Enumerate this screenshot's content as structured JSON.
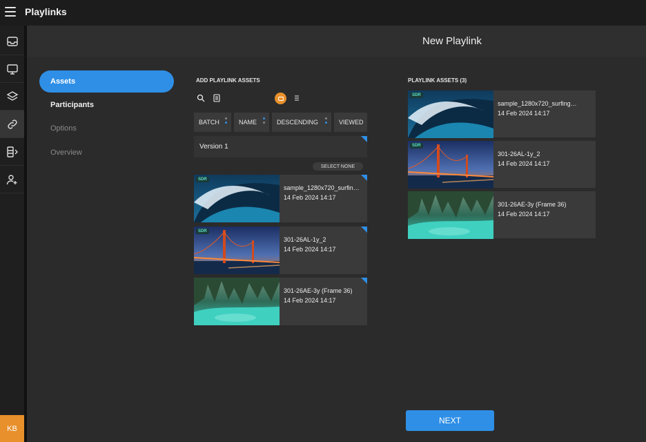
{
  "app": {
    "title": "Playlinks"
  },
  "header": {
    "title": "New Playlink"
  },
  "user": {
    "initials": "KB"
  },
  "colors": {
    "accent": "#2f8fe6",
    "highlight": "#e8902b",
    "sdr_badge": "#5de0c8"
  },
  "nav": [
    {
      "icon": "inbox-icon",
      "active": false
    },
    {
      "icon": "monitor-icon",
      "active": false
    },
    {
      "icon": "layers-icon",
      "active": false
    },
    {
      "icon": "link-icon",
      "active": true
    },
    {
      "icon": "storage-icon",
      "active": false
    },
    {
      "icon": "user-settings-icon",
      "active": false
    }
  ],
  "steps": [
    {
      "label": "Assets",
      "state": "active"
    },
    {
      "label": "Participants",
      "state": "done"
    },
    {
      "label": "Options",
      "state": "disabled"
    },
    {
      "label": "Overview",
      "state": "disabled"
    }
  ],
  "add_section": {
    "title": "ADD PLAYLINK ASSETS",
    "toolbar": {
      "search": "search-icon",
      "doc": "document-icon",
      "grid": "tile-view-icon",
      "list": "list-view-icon"
    },
    "sort": {
      "batch": "BATCH",
      "name": "NAME",
      "order": "DESCENDING",
      "viewed": "VIEWED"
    },
    "version": "Version 1",
    "select_none": "SELECT NONE",
    "assets": [
      {
        "name": "sample_1280x720_surfin…",
        "date": "14 Feb 2024 14:17",
        "badge": "SDR",
        "thumb": "wave"
      },
      {
        "name": "301-26AL-1y_2",
        "date": "14 Feb 2024 14:17",
        "badge": "SDR",
        "thumb": "bridge"
      },
      {
        "name": "301-26AE-3y (Frame 36)",
        "date": "14 Feb 2024 14:17",
        "badge": "",
        "thumb": "lake"
      }
    ]
  },
  "playlink_section": {
    "title": "PLAYLINK ASSETS (3)",
    "assets": [
      {
        "name": "sample_1280x720_surfing…",
        "date": "14 Feb 2024 14:17",
        "badge": "SDR",
        "thumb": "wave"
      },
      {
        "name": "301-26AL-1y_2",
        "date": "14 Feb 2024 14:17",
        "badge": "SDR",
        "thumb": "bridge"
      },
      {
        "name": "301-26AE-3y (Frame 36)",
        "date": "14 Feb 2024 14:17",
        "badge": "",
        "thumb": "lake"
      }
    ]
  },
  "actions": {
    "next": "NEXT"
  }
}
